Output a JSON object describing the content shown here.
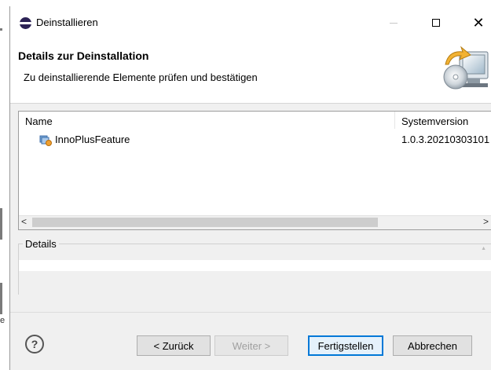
{
  "window": {
    "title": "Deinstallieren",
    "close_glyph": "✕"
  },
  "header": {
    "title": "Details zur Deinstallation",
    "description": "Zu deinstallierende Elemente prüfen und bestätigen",
    "icon": "wizard-computer-cd-icon"
  },
  "table": {
    "columns": [
      "Name",
      "Systemversion"
    ],
    "rows": [
      {
        "name": "InnoPlusFeature",
        "version": "1.0.3.20210303101",
        "icon": "feature-plugin-icon"
      }
    ],
    "scroll_left": "<",
    "scroll_right": ">"
  },
  "details": {
    "label": "Details",
    "text": ""
  },
  "footer": {
    "help": "?",
    "back": "< Zurück",
    "next": "Weiter >",
    "finish": "Fertigstellen",
    "cancel": "Abbrechen"
  },
  "background": {
    "fragment": "e"
  },
  "colors": {
    "focus_border": "#0078d7",
    "window_bg": "#f0f0f0"
  }
}
